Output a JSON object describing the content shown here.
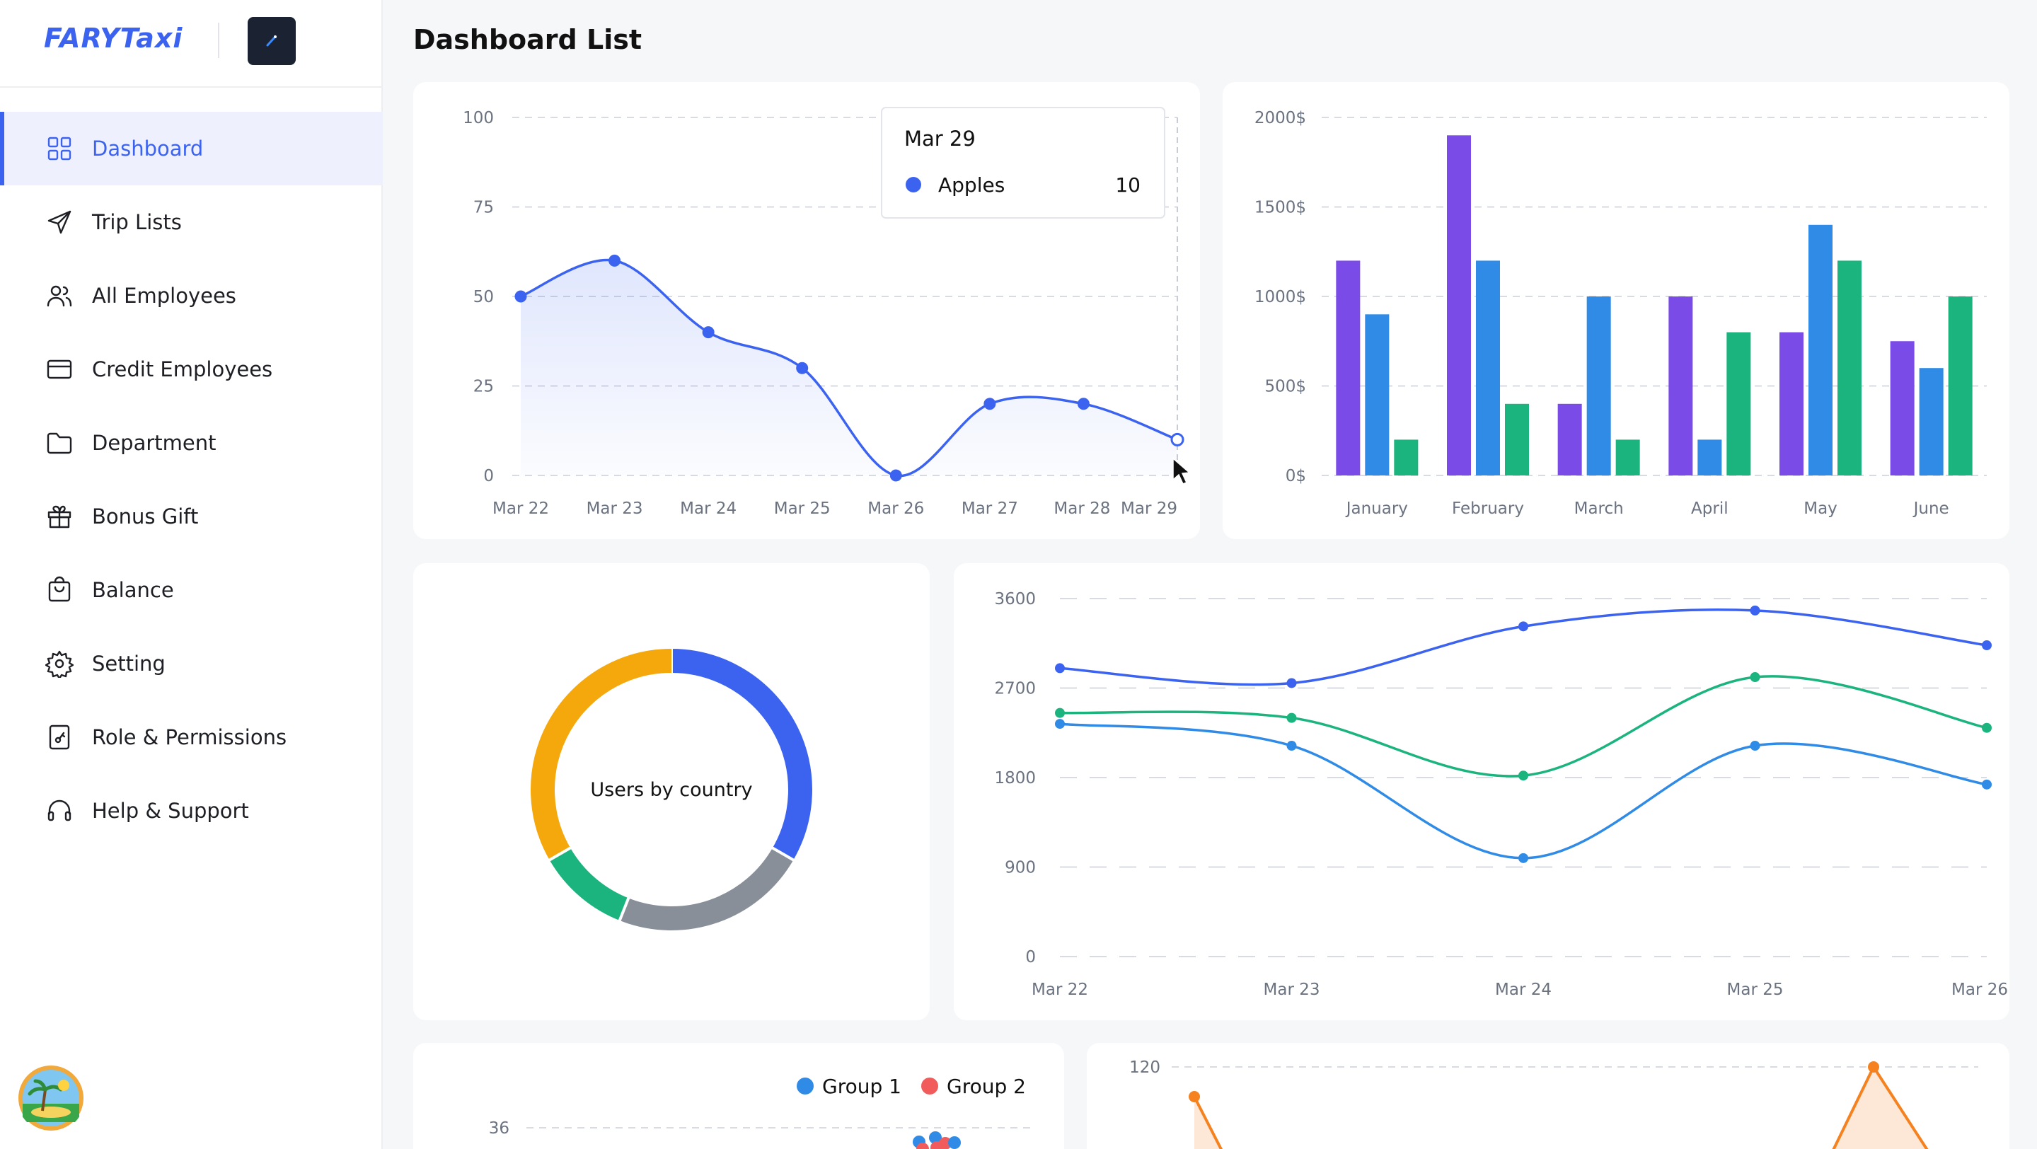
{
  "app": {
    "name": "FARYTaxi"
  },
  "page": {
    "title": "Dashboard List"
  },
  "colors": {
    "accent": "#3b63f0",
    "purple": "#7b4be8",
    "blue": "#2f8be5",
    "green": "#1bb47e",
    "orange": "#f5a80b",
    "gray": "#888f99",
    "scatter_red": "#f25b5b",
    "area_orange": "#f5821f"
  },
  "nav": [
    {
      "label": "Dashboard",
      "icon": "grid-icon",
      "active": true
    },
    {
      "label": "Trip Lists",
      "icon": "send-icon"
    },
    {
      "label": "All Employees",
      "icon": "users-icon"
    },
    {
      "label": "Credit Employees",
      "icon": "credit-card-icon"
    },
    {
      "label": "Department",
      "icon": "folder-icon"
    },
    {
      "label": "Bonus Gift",
      "icon": "gift-icon"
    },
    {
      "label": "Balance",
      "icon": "bag-icon"
    },
    {
      "label": "Setting",
      "icon": "gear-icon"
    },
    {
      "label": "Role & Permissions",
      "icon": "key-document-icon"
    },
    {
      "label": "Help & Support",
      "icon": "headset-icon"
    }
  ],
  "chart_data": [
    {
      "type": "area",
      "x": [
        "Mar 22",
        "Mar 23",
        "Mar 24",
        "Mar 25",
        "Mar 26",
        "Mar 27",
        "Mar 28",
        "Mar 29"
      ],
      "series": [
        {
          "name": "Apples",
          "values": [
            50,
            60,
            40,
            30,
            0,
            20,
            20,
            10
          ]
        }
      ],
      "ylim": [
        0,
        100
      ],
      "yticks": [
        0,
        25,
        50,
        75,
        100
      ],
      "grid": true,
      "tooltip": {
        "title": "Mar 29",
        "series": "Apples",
        "value": "10"
      }
    },
    {
      "type": "bar",
      "categories": [
        "January",
        "February",
        "March",
        "April",
        "May",
        "June"
      ],
      "series": [
        {
          "values": [
            1200,
            1900,
            400,
            1000,
            800,
            750
          ]
        },
        {
          "values": [
            900,
            1200,
            1000,
            200,
            1400,
            600
          ]
        },
        {
          "values": [
            200,
            400,
            200,
            800,
            1200,
            1000
          ]
        }
      ],
      "ylim": [
        0,
        2000
      ],
      "yticks": [
        "0$",
        "500$",
        "1000$",
        "1500$",
        "2000$"
      ],
      "grid": true
    },
    {
      "type": "pie",
      "donut": true,
      "center_label": "Users by country",
      "slices": [
        {
          "color": "#3b63f0",
          "value": 25
        },
        {
          "color": "#888f99",
          "value": 17
        },
        {
          "color": "#1bb47e",
          "value": 8
        },
        {
          "color": "#f5a80b",
          "value": 25
        }
      ]
    },
    {
      "type": "line",
      "x": [
        "Mar 22",
        "Mar 23",
        "Mar 24",
        "Mar 25",
        "Mar 26"
      ],
      "series": [
        {
          "values": [
            2900,
            2750,
            3320,
            3480,
            3130
          ]
        },
        {
          "values": [
            2450,
            2400,
            1820,
            2810,
            2300
          ]
        },
        {
          "values": [
            2340,
            2120,
            990,
            2120,
            1730
          ]
        }
      ],
      "ylim": [
        0,
        3600
      ],
      "yticks": [
        0,
        900,
        1800,
        2700,
        3600
      ],
      "grid": true
    },
    {
      "type": "scatter",
      "legend": [
        "Group 1",
        "Group 2"
      ],
      "legend_position": "top-right",
      "yticks_visible": [
        36
      ]
    },
    {
      "type": "area",
      "yticks_visible": [
        120
      ]
    }
  ]
}
